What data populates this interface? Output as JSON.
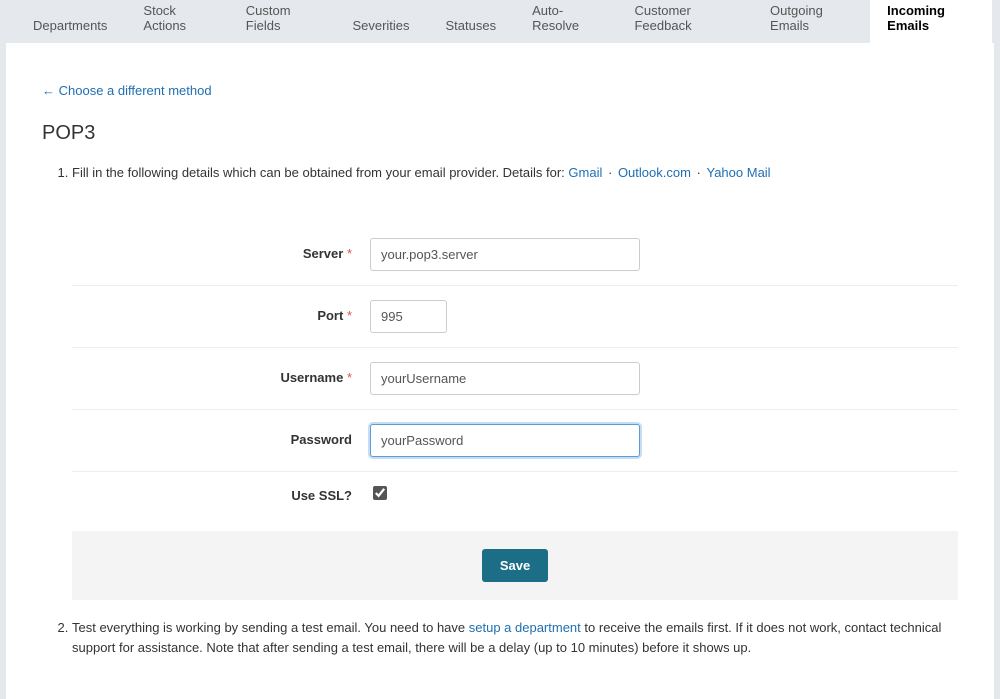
{
  "tabs": [
    {
      "label": "Departments",
      "active": false
    },
    {
      "label": "Stock Actions",
      "active": false
    },
    {
      "label": "Custom Fields",
      "active": false
    },
    {
      "label": "Severities",
      "active": false
    },
    {
      "label": "Statuses",
      "active": false
    },
    {
      "label": "Auto-Resolve",
      "active": false
    },
    {
      "label": "Customer Feedback",
      "active": false
    },
    {
      "label": "Outgoing Emails",
      "active": false
    },
    {
      "label": "Incoming Emails",
      "active": true
    }
  ],
  "back_link": "← Choose a different method",
  "page_title": "POP3",
  "step1_intro": "Fill in the following details which can be obtained from your email provider. Details for: ",
  "providers": {
    "gmail": "Gmail",
    "outlook": "Outlook.com",
    "yahoo": "Yahoo Mail"
  },
  "form": {
    "server": {
      "label": "Server",
      "required": "*",
      "value": "your.pop3.server"
    },
    "port": {
      "label": "Port",
      "required": "*",
      "value": "995"
    },
    "username": {
      "label": "Username",
      "required": "*",
      "value": "yourUsername"
    },
    "password": {
      "label": "Password",
      "value": "yourPassword"
    },
    "use_ssl": {
      "label": "Use SSL?",
      "checked": true
    }
  },
  "save_label": "Save",
  "step2": {
    "prefix": "Test everything is working by sending a test email. You need to have ",
    "link": "setup a department",
    "suffix": " to receive the emails first. If it does not work, contact technical support for assistance. Note that after sending a test email, there will be a delay (up to 10 minutes) before it shows up."
  }
}
